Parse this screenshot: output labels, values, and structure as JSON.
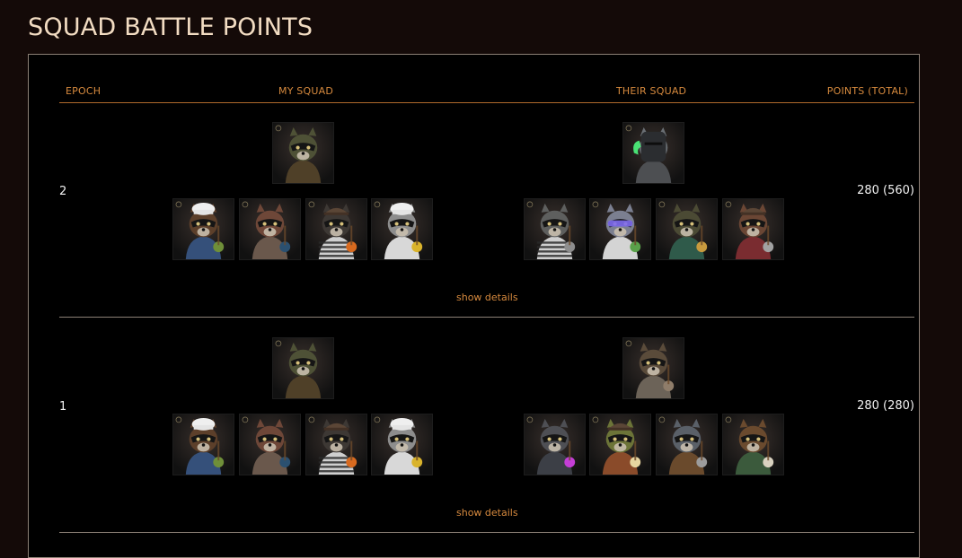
{
  "page": {
    "title": "SQUAD BATTLE POINTS"
  },
  "table": {
    "headers": {
      "epoch": "EPOCH",
      "my_squad": "MY SQUAD",
      "their_squad": "THEIR SQUAD",
      "points": "POINTS (TOTAL)"
    },
    "rows": [
      {
        "epoch": "2",
        "points": "280 (560)",
        "show_details": "show details",
        "my_squad": {
          "leader": {
            "fur": "#4e5136",
            "bg": "#39302c",
            "outfit": "#4f4028",
            "hat": "none"
          },
          "members": [
            {
              "fur": "#5c3f2a",
              "bg": "#3d3a34",
              "outfit": "#35507a",
              "hat": "chef",
              "prop": "#6f8f39"
            },
            {
              "fur": "#6e4738",
              "bg": "#4a3027",
              "outfit": "#6a584c",
              "hat": "none",
              "prop": "#2b5070"
            },
            {
              "fur": "#3d3834",
              "bg": "#4a312a",
              "outfit": "stripes",
              "hat": "beanie",
              "prop": "#d86a1f"
            },
            {
              "fur": "#8d8d8d",
              "bg": "#3a3a36",
              "outfit": "#d8d8d8",
              "hat": "chef",
              "prop": "#d9b32c"
            }
          ]
        },
        "their_squad": {
          "leader": {
            "fur": "#6a6f74",
            "bg": "#3b4246",
            "outfit": "#4d4f52",
            "hat": "knight",
            "prop": "#4ef77e"
          },
          "members": [
            {
              "fur": "#5e5f5e",
              "bg": "#3a3d3c",
              "outfit": "stripes",
              "hat": "none",
              "prop": "#8e8e8e"
            },
            {
              "fur": "#7b7f90",
              "bg": "#3c414c",
              "outfit": "#d4d4d4",
              "hat": "visor",
              "prop": "#5aa14a"
            },
            {
              "fur": "#4b4a34",
              "bg": "#303d36",
              "outfit": "#2f5a4a",
              "hat": "none",
              "prop": "#c89a3e"
            },
            {
              "fur": "#6a4634",
              "bg": "#3e3a36",
              "outfit": "#7a2c30",
              "hat": "beanie",
              "prop": "#a2a2a2"
            }
          ]
        }
      },
      {
        "epoch": "1",
        "points": "280 (280)",
        "show_details": "show details",
        "my_squad": {
          "leader": {
            "fur": "#4e5136",
            "bg": "#39302c",
            "outfit": "#4f4028",
            "hat": "none"
          },
          "members": [
            {
              "fur": "#5c3f2a",
              "bg": "#3d3a34",
              "outfit": "#35507a",
              "hat": "chef",
              "prop": "#6f8f39"
            },
            {
              "fur": "#6e4738",
              "bg": "#4a3027",
              "outfit": "#6a584c",
              "hat": "none",
              "prop": "#2b5070"
            },
            {
              "fur": "#3d3834",
              "bg": "#4a312a",
              "outfit": "stripes",
              "hat": "beanie",
              "prop": "#d86a1f"
            },
            {
              "fur": "#8d8d8d",
              "bg": "#3a3a36",
              "outfit": "#d8d8d8",
              "hat": "chef",
              "prop": "#d9b32c"
            }
          ]
        },
        "their_squad": {
          "leader": {
            "fur": "#5a4b3a",
            "bg": "#3b3832",
            "outfit": "#6c6358",
            "hat": "none",
            "prop": "#8f7d6a"
          },
          "members": [
            {
              "fur": "#4e4f54",
              "bg": "#2c2e34",
              "outfit": "#3c3f46",
              "hat": "none",
              "prop": "#c43ed6"
            },
            {
              "fur": "#6c7438",
              "bg": "#33381f",
              "outfit": "#8a4b2a",
              "hat": "beanie",
              "prop": "#e7d6a0"
            },
            {
              "fur": "#5a6068",
              "bg": "#2d3440",
              "outfit": "#6a4a2c",
              "hat": "none",
              "prop": "#9c9c9c"
            },
            {
              "fur": "#6a4a2e",
              "bg": "#3a2f29",
              "outfit": "#3b5a3c",
              "hat": "none",
              "prop": "#d9d2c0"
            }
          ]
        }
      }
    ]
  }
}
